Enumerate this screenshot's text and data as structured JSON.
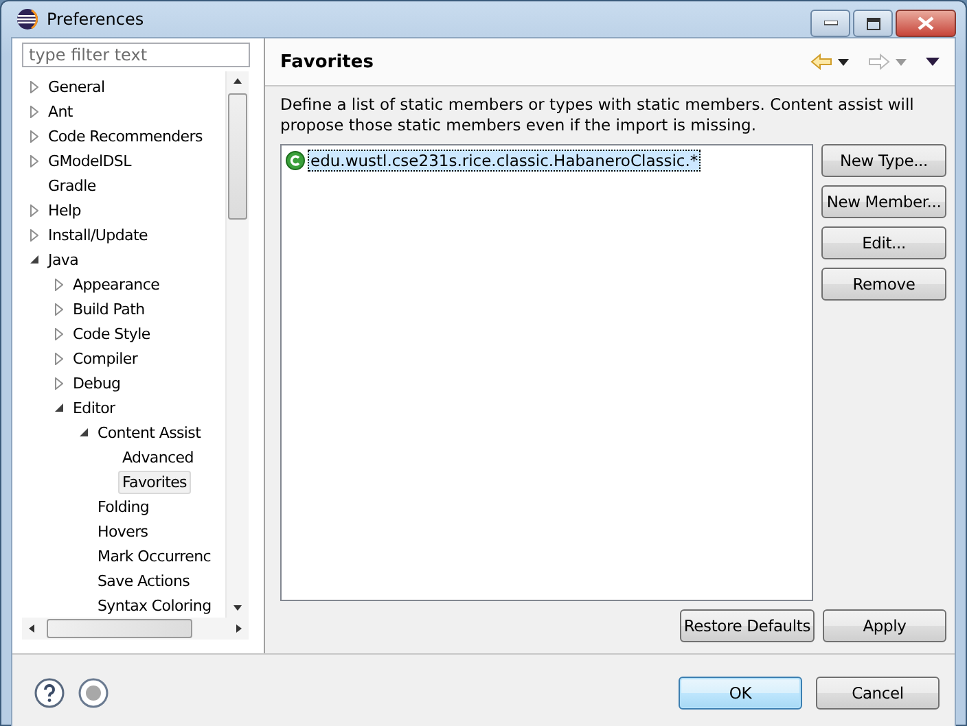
{
  "window": {
    "title": "Preferences"
  },
  "filter": {
    "placeholder": "type filter text"
  },
  "tree": [
    {
      "label": "General",
      "expanded": false,
      "selected": false
    },
    {
      "label": "Ant",
      "expanded": false,
      "selected": false
    },
    {
      "label": "Code Recommenders",
      "expanded": false,
      "selected": false
    },
    {
      "label": "GModelDSL",
      "expanded": false,
      "selected": false
    },
    {
      "label": "Gradle",
      "selected": false
    },
    {
      "label": "Help",
      "expanded": false,
      "selected": false
    },
    {
      "label": "Install/Update",
      "expanded": false,
      "selected": false
    },
    {
      "label": "Java",
      "expanded": true,
      "selected": false,
      "children": [
        {
          "label": "Appearance",
          "expanded": false,
          "selected": false
        },
        {
          "label": "Build Path",
          "expanded": false,
          "selected": false
        },
        {
          "label": "Code Style",
          "expanded": false,
          "selected": false
        },
        {
          "label": "Compiler",
          "expanded": false,
          "selected": false
        },
        {
          "label": "Debug",
          "expanded": false,
          "selected": false
        },
        {
          "label": "Editor",
          "expanded": true,
          "selected": false,
          "children": [
            {
              "label": "Content Assist",
              "expanded": true,
              "selected": false,
              "children": [
                {
                  "label": "Advanced",
                  "selected": false
                },
                {
                  "label": "Favorites",
                  "selected": true
                }
              ]
            },
            {
              "label": "Folding",
              "selected": false
            },
            {
              "label": "Hovers",
              "selected": false
            },
            {
              "label": "Mark Occurrenc",
              "selected": false
            },
            {
              "label": "Save Actions",
              "selected": false
            },
            {
              "label": "Syntax Coloring",
              "selected": false
            }
          ]
        }
      ]
    }
  ],
  "page": {
    "title": "Favorites",
    "description": "Define a list of static members or types with static members. Content assist will propose those static members even if the import is missing.",
    "favorites": [
      {
        "label": "edu.wustl.cse231s.rice.classic.HabaneroClassic.*",
        "selected": true
      }
    ],
    "side_buttons": [
      "New Type...",
      "New Member...",
      "Edit...",
      "Remove"
    ],
    "buttons": [
      "Restore Defaults",
      "Apply"
    ]
  },
  "dialog_buttons": [
    {
      "label": "OK",
      "default": true
    },
    {
      "label": "Cancel",
      "default": false
    }
  ]
}
